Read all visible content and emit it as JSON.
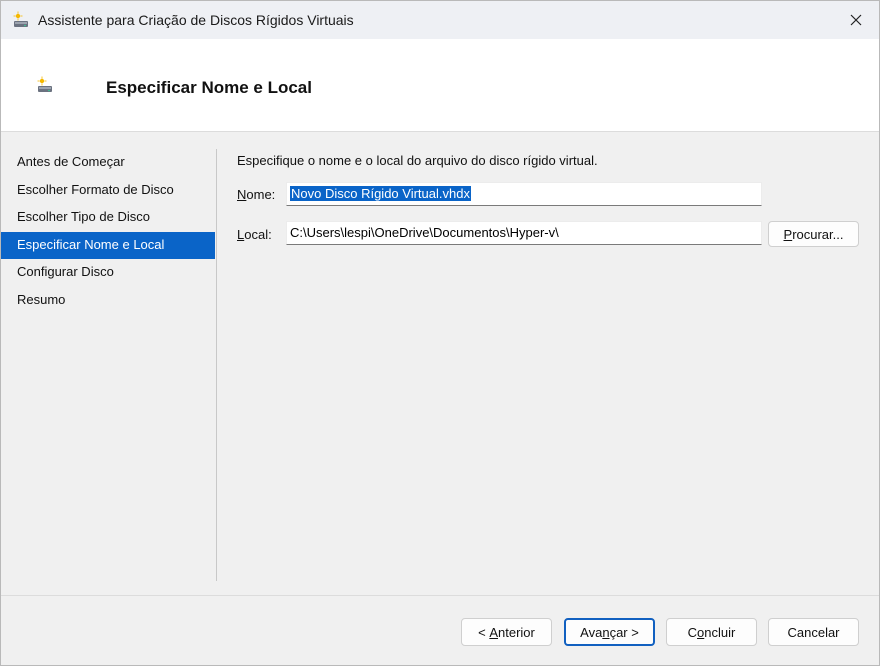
{
  "window": {
    "title": "Assistente para Criação de Discos Rígidos Virtuais",
    "close_icon": "close-icon",
    "app_icon": "virtual-disk-icon"
  },
  "header": {
    "title": "Especificar Nome e Local",
    "icon": "virtual-disk-icon"
  },
  "nav": {
    "items": [
      {
        "label": "Antes de Começar",
        "active": false
      },
      {
        "label": "Escolher Formato de Disco",
        "active": false
      },
      {
        "label": "Escolher Tipo de Disco",
        "active": false
      },
      {
        "label": "Especificar Nome e Local",
        "active": true
      },
      {
        "label": "Configurar Disco",
        "active": false
      },
      {
        "label": "Resumo",
        "active": false
      }
    ]
  },
  "content": {
    "instruction": "Especifique o nome e o local do arquivo do disco rígido virtual.",
    "name_label_accel": "N",
    "name_label_rest": "ome:",
    "name_value": "Novo Disco Rígido Virtual.vhdx",
    "location_label_accel": "L",
    "location_label_rest": "ocal:",
    "location_value": "C:\\Users\\lespi\\OneDrive\\Documentos\\Hyper-v\\",
    "browse_accel": "P",
    "browse_rest": "rocurar..."
  },
  "footer": {
    "previous_prefix": "< ",
    "previous_accel": "A",
    "previous_rest": "nterior",
    "next_pre": "Ava",
    "next_accel": "n",
    "next_rest": "çar >",
    "finish_pre": "C",
    "finish_accel": "o",
    "finish_rest": "ncluir",
    "cancel_label": "Cancelar"
  },
  "colors": {
    "accent": "#0a64c8",
    "window_bg": "#f0f0f0",
    "header_bg": "#ffffff"
  }
}
